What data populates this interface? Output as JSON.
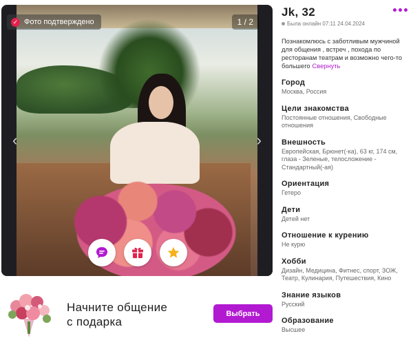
{
  "photo": {
    "verified_label": "Фото подтверждено",
    "counter": "1 / 2",
    "prev_arrow": "‹",
    "next_arrow": "›",
    "actions": [
      {
        "icon": "message-icon",
        "color": "#b21ad1"
      },
      {
        "icon": "gift-icon",
        "color": "#e0234d"
      },
      {
        "icon": "star-icon",
        "color": "#f5b21b"
      }
    ]
  },
  "gift_bar": {
    "text_line1": "Начните общение",
    "text_line2": "с подарка",
    "button_label": "Выбрать"
  },
  "profile": {
    "name": "Jk, 32",
    "online_status": "Была онлайн 07:11 24.04.2024",
    "bio": "Познакомлюсь с заботливым мужчиной для общения , встреч , похода по ресторанам театрам и возможно чего-то большего",
    "bio_toggle": "Свернуть",
    "sections": [
      {
        "title": "Город",
        "value": "Москва, Россия"
      },
      {
        "title": "Цели знакомства",
        "value": "Постоянные отношения, Свободные отношения"
      },
      {
        "title": "Внешность",
        "value": "Европейская, Брюнет(-ка), 63 кг, 174 см, глаза - Зеленые, телосложение - Стандартный(-ая)"
      },
      {
        "title": "Ориентация",
        "value": "Гетеро"
      },
      {
        "title": "Дети",
        "value": "Детей нет"
      },
      {
        "title": "Отношение к курению",
        "value": "Не курю"
      },
      {
        "title": "Хобби",
        "value": "Дизайн, Медицина, Фитнес, спорт, ЗОЖ, Театр, Кулинария, Путешествия, Кино"
      },
      {
        "title": "Знание языков",
        "value": "Русский"
      },
      {
        "title": "Образование",
        "value": "Высшее"
      }
    ]
  },
  "colors": {
    "accent": "#b21ad1",
    "verified": "#e0234d"
  }
}
